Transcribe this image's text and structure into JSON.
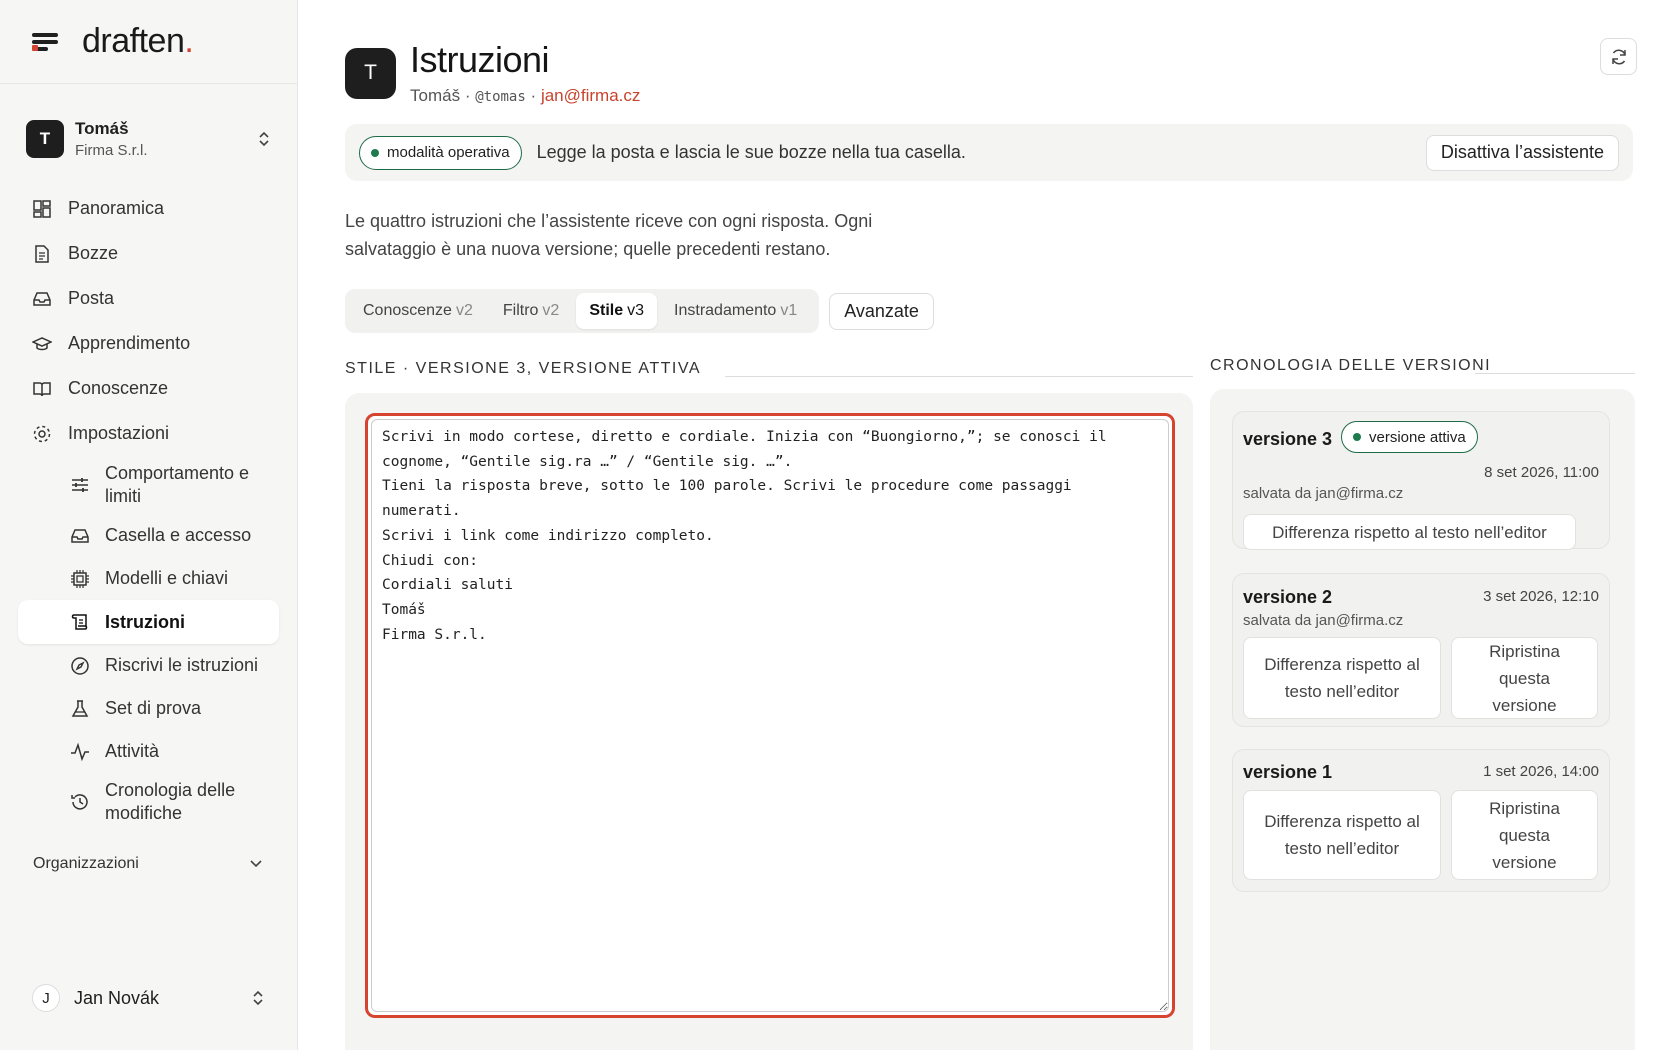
{
  "brand": {
    "name": "draften",
    "dot": "."
  },
  "account": {
    "initial": "T",
    "name": "Tomáš",
    "org": "Firma S.r.l."
  },
  "nav": [
    {
      "label": "Panoramica",
      "icon": "dashboard-icon"
    },
    {
      "label": "Bozze",
      "icon": "document-icon"
    },
    {
      "label": "Posta",
      "icon": "inbox-icon"
    },
    {
      "label": "Apprendimento",
      "icon": "graduation-cap-icon"
    },
    {
      "label": "Conoscenze",
      "icon": "book-icon"
    },
    {
      "label": "Impostazioni",
      "icon": "gear-icon"
    }
  ],
  "subnav": [
    {
      "label": "Comportamento e limiti",
      "icon": "sliders-icon"
    },
    {
      "label": "Casella e accesso",
      "icon": "inbox-icon"
    },
    {
      "label": "Modelli e chiavi",
      "icon": "chip-icon"
    },
    {
      "label": "Istruzioni",
      "icon": "scroll-icon",
      "active": true
    },
    {
      "label": "Riscrivi le istruzioni",
      "icon": "compass-icon"
    },
    {
      "label": "Set di prova",
      "icon": "flask-icon"
    },
    {
      "label": "Attività",
      "icon": "activity-icon"
    },
    {
      "label": "Cronologia delle modifiche",
      "icon": "history-icon"
    }
  ],
  "orgs_label": "Organizzazioni",
  "footer_user": {
    "initial": "J",
    "name": "Jan Novák"
  },
  "page": {
    "initial": "T",
    "title": "Istruzioni",
    "name": "Tomáš",
    "sep": "·",
    "handle": "@tomas",
    "email": "jan@firma.cz"
  },
  "mode": {
    "pill": "modalità operativa",
    "message": "Legge la posta e lascia le sue bozze nella tua casella.",
    "disable_button": "Disattiva l’assistente"
  },
  "intro": "Le quattro istruzioni che l’assistente riceve con ogni risposta. Ogni salvataggio è una nuova versione; quelle precedenti restano.",
  "tabs": [
    {
      "label": "Conoscenze",
      "version": "v2",
      "active": false
    },
    {
      "label": "Filtro",
      "version": "v2",
      "active": false
    },
    {
      "label": "Stile",
      "version": "v3",
      "active": true
    },
    {
      "label": "Instradamento",
      "version": "v1",
      "active": false
    }
  ],
  "advanced_button": "Avanzate",
  "editor_section": "STILE · VERSIONE 3, VERSIONE ATTIVA",
  "history_section": "CRONOLOGIA DELLE VERSIONI",
  "editor_text": "Scrivi in modo cortese, diretto e cordiale. Inizia con “Buongiorno,”; se conosci il\ncognome, “Gentile sig.ra …” / “Gentile sig. …”.\nTieni la risposta breve, sotto le 100 parole. Scrivi le procedure come passaggi\nnumerati.\nScrivi i link come indirizzo completo.\nChiudi con:\nCordiali saluti\nTomáš\nFirma S.r.l.",
  "versions": [
    {
      "title": "versione 3",
      "badge": "versione attiva",
      "date": "8 set 2026, 11:00",
      "saved_by": "salvata da jan@firma.cz",
      "diff": "Differenza rispetto al testo nell’editor"
    },
    {
      "title": "versione 2",
      "date": "3 set 2026, 12:10",
      "saved_by": "salvata da jan@firma.cz",
      "diff": "Differenza rispetto al testo nell’editor",
      "restore": "Ripristina questa versione"
    },
    {
      "title": "versione 1",
      "date": "1 set 2026, 14:00",
      "diff": "Differenza rispetto al testo nell’editor",
      "restore": "Ripristina questa versione"
    }
  ],
  "colors": {
    "accent": "#d3432f",
    "active_green": "#1f7a4e",
    "email": "#c8432e"
  }
}
